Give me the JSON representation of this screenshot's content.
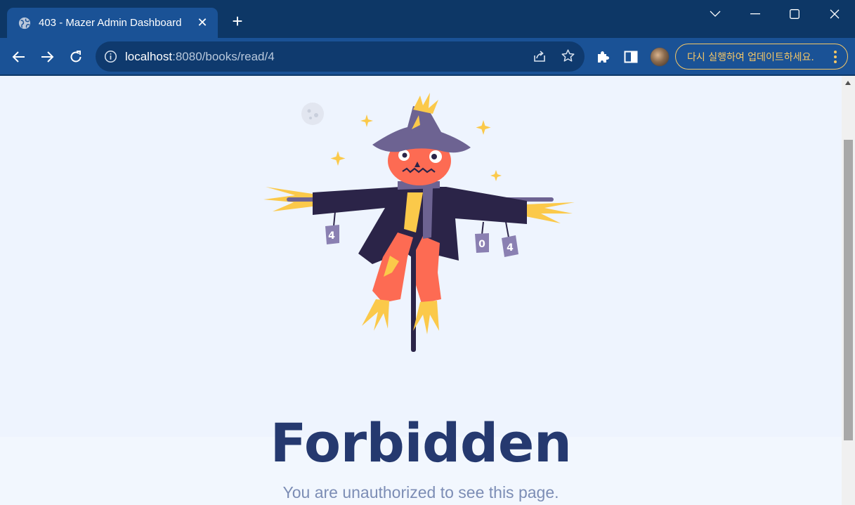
{
  "browser": {
    "tab_title": "403 - Mazer Admin Dashboard",
    "url_host": "localhost",
    "url_path": ":8080/books/read/4",
    "update_button_label": "다시 실행하여 업데이트하세요."
  },
  "page": {
    "illustration_labels": [
      "4",
      "0",
      "4"
    ],
    "title": "Forbidden",
    "subtitle": "You are unauthorized to see this page."
  },
  "colors": {
    "title": "#25396f",
    "subtitle": "#7c8db5",
    "background": "#eef4fe",
    "browser_frame": "#1a5296",
    "accent": "#f6c766"
  },
  "icons": {
    "tab": "globe-icon",
    "back": "back-arrow-icon",
    "forward": "forward-arrow-icon",
    "reload": "reload-icon",
    "site_info": "info-icon",
    "share": "share-icon",
    "bookmark": "star-icon",
    "extensions": "puzzle-icon",
    "side_panel": "side-panel-icon",
    "menu": "kebab-menu-icon"
  }
}
